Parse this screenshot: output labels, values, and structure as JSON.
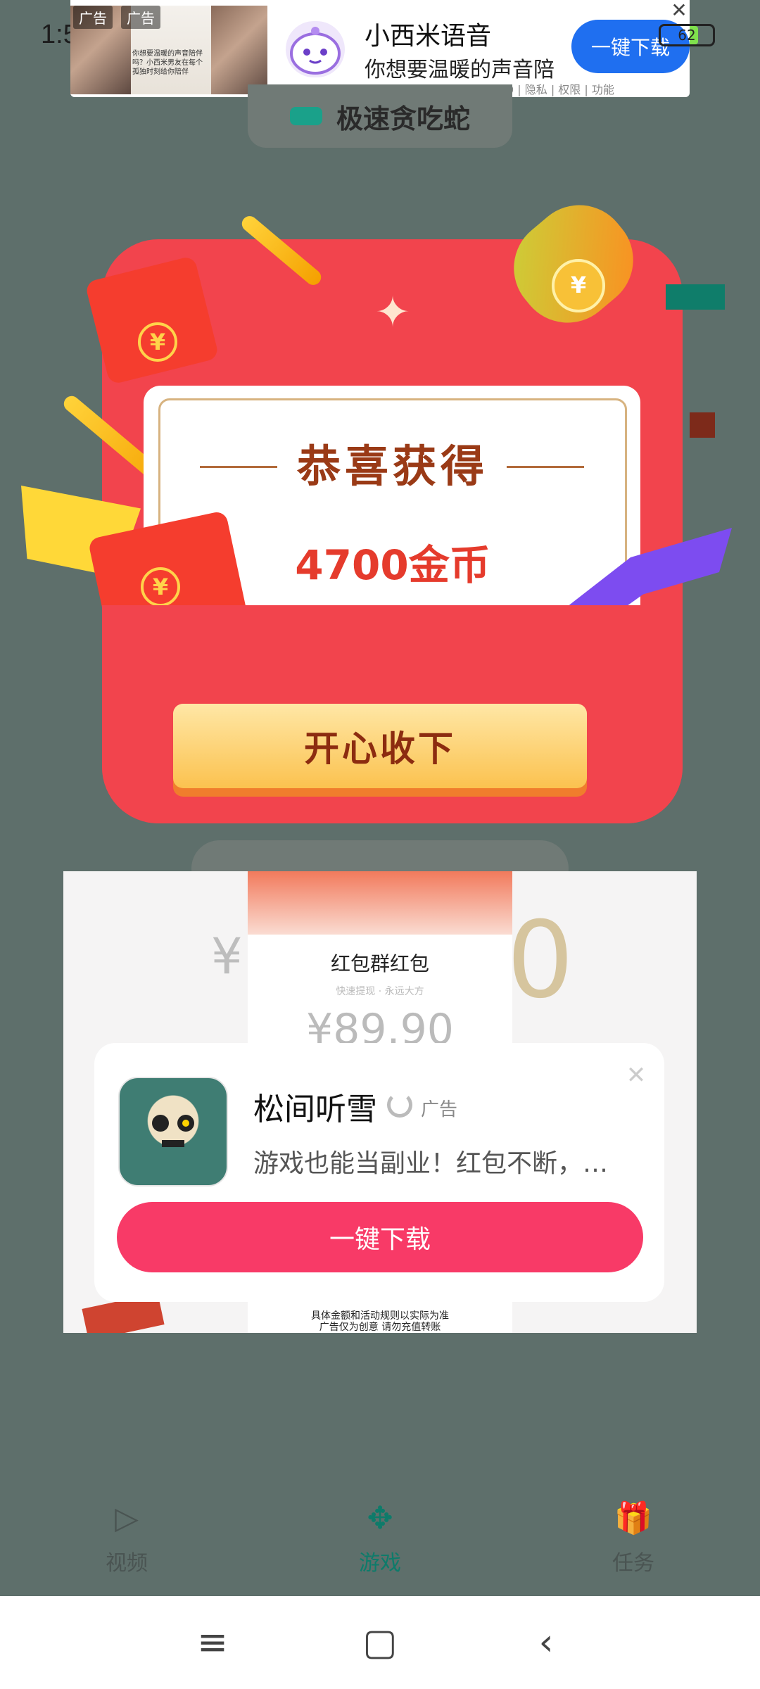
{
  "status": {
    "time": "1:51",
    "battery": "62"
  },
  "top_ad": {
    "tag": "广告",
    "img_text": "你想要温暖的声音陪伴吗？小西米男友在每个孤独时刻给你陪伴",
    "app_name": "小西米语音",
    "app_desc": "你想要温暖的声音陪",
    "meta": "v5.6.0 | 隐私 | 权限 | 功能",
    "download": "一键下载",
    "close": "✕"
  },
  "game": {
    "title": "极速贪吃蛇"
  },
  "reward": {
    "heading": "恭喜获得",
    "amount": "4700金币",
    "accept": "开心收下",
    "yen": "¥",
    "sparkle": "✦"
  },
  "interstitial": {
    "bg_yen": "¥",
    "bg_zero": "0",
    "title": "红包群红包",
    "subtitle": "快速提现 · 永远大方",
    "amount": "¥89.90",
    "footnote": "具体金额和活动规则以实际为准\n广告仅为创意 请勿充值转账",
    "card": {
      "close": "✕",
      "name": "松间听雪",
      "tag": "广告",
      "desc": "游戏也能当副业！红包不断，…",
      "download": "一键下载"
    }
  },
  "tabs": [
    {
      "label": "视频",
      "icon": "play-icon",
      "glyph": "▷",
      "active": false
    },
    {
      "label": "游戏",
      "icon": "gamepad-icon",
      "glyph": "✥",
      "active": true
    },
    {
      "label": "任务",
      "icon": "gift-icon",
      "glyph": "🎁",
      "active": false
    }
  ],
  "sysnav": {
    "menu": "≡",
    "home": "▢",
    "back": "‹"
  }
}
